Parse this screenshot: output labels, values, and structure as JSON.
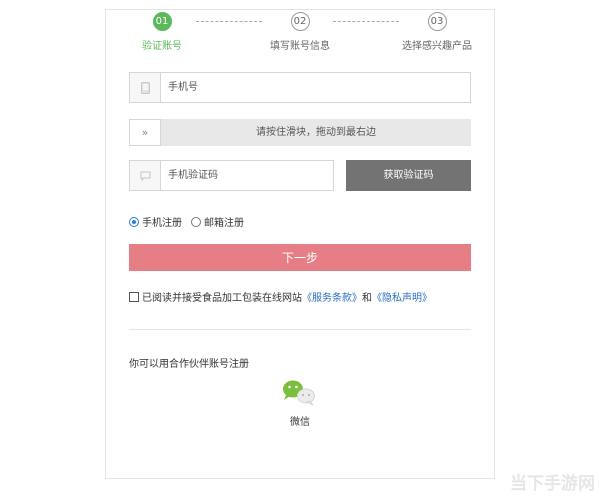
{
  "steps": [
    {
      "num": "01",
      "label": "验证账号",
      "active": true
    },
    {
      "num": "02",
      "label": "填写账号信息",
      "active": false
    },
    {
      "num": "03",
      "label": "选择感兴趣产品",
      "active": false
    }
  ],
  "phone": {
    "placeholder": "手机号"
  },
  "slider": {
    "handle": "»",
    "hint": "请按住滑块，拖动到最右边"
  },
  "sms": {
    "placeholder": "手机验证码",
    "button_label": "获取验证码"
  },
  "register_type": {
    "options": [
      {
        "label": "手机注册",
        "selected": true
      },
      {
        "label": "邮箱注册",
        "selected": false
      }
    ]
  },
  "next_button": "下一步",
  "agreement": {
    "prefix": "已阅读并接受食品加工包装在线网站",
    "service_link": "《服务条款》",
    "and": "和",
    "privacy_link": "《隐私声明》"
  },
  "partner": {
    "title": "你可以用合作伙伴账号注册",
    "wechat_label": "微信"
  },
  "watermark": "当下手游网",
  "colors": {
    "accent_green": "#5cb85c",
    "next_button_bg": "#e67e86",
    "sms_button_bg": "#737373",
    "link_blue": "#2a6fc4"
  },
  "icons": {
    "phone": "phone-icon",
    "sms": "message-icon",
    "slider": "double-chevron-right-icon",
    "wechat": "wechat-icon"
  }
}
